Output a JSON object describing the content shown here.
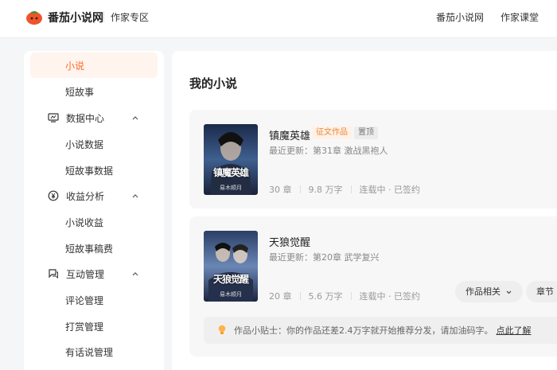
{
  "header": {
    "brand": "番茄小说网",
    "sub": "作家专区",
    "nav": [
      "番茄小说网",
      "作家课堂"
    ]
  },
  "sidebar": {
    "items": [
      {
        "label": "小说",
        "type": "child",
        "active": true
      },
      {
        "label": "短故事",
        "type": "child"
      },
      {
        "label": "数据中心",
        "type": "group",
        "icon": "monitor-icon"
      },
      {
        "label": "小说数据",
        "type": "child"
      },
      {
        "label": "短故事数据",
        "type": "child"
      },
      {
        "label": "收益分析",
        "type": "group",
        "icon": "yen-coin-icon"
      },
      {
        "label": "小说收益",
        "type": "child"
      },
      {
        "label": "短故事稿费",
        "type": "child"
      },
      {
        "label": "互动管理",
        "type": "group",
        "icon": "chat-icon"
      },
      {
        "label": "评论管理",
        "type": "child"
      },
      {
        "label": "打赏管理",
        "type": "child"
      },
      {
        "label": "有话说管理",
        "type": "child"
      }
    ]
  },
  "main": {
    "title": "我的小说",
    "books": [
      {
        "title": "镇魔英雄",
        "tags": [
          "征文作品",
          "置顶"
        ],
        "update": "最近更新：第31章 激战黑袍人",
        "chapters": "30 章",
        "words": "9.8 万字",
        "status": "连载中 · 已签约",
        "cover_text": "镇魔英雄",
        "cover_author": "易木顺月"
      },
      {
        "title": "天狼觉醒",
        "update": "最近更新：第20章 武学复兴",
        "chapters": "20 章",
        "words": "5.6 万字",
        "status": "连载中 · 已签约",
        "cover_text": "天狼觉醒",
        "cover_author": "易木顺月",
        "buttons": [
          "作品相关",
          "章节"
        ],
        "tip": "作品小贴士：你的作品还差2.4万字就开始推荐分发，请加油码字。",
        "tip_link": "点此了解"
      }
    ]
  },
  "colors": {
    "accent": "#ff6a2a",
    "contest_tag": "#e8893c"
  }
}
